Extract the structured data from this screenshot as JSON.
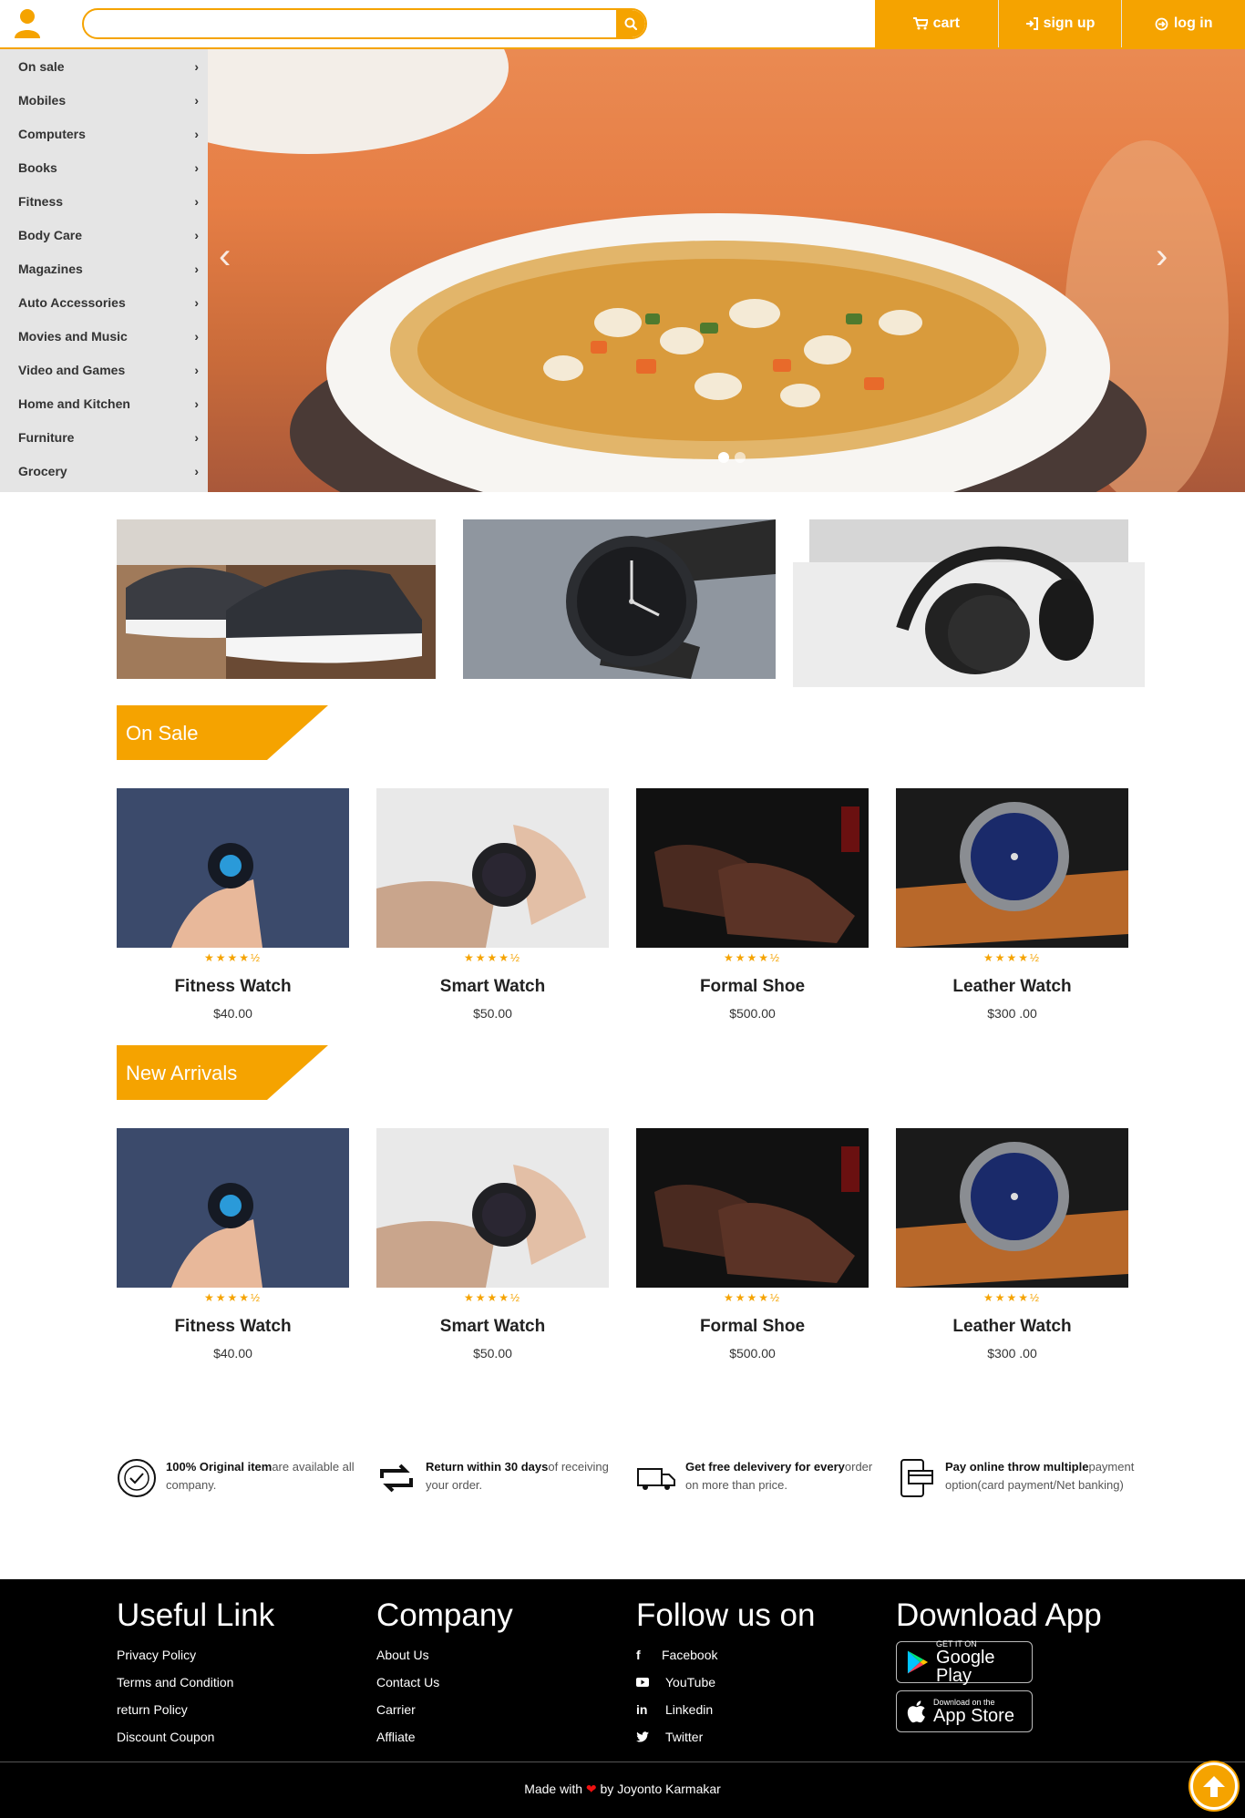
{
  "header": {
    "search_placeholder": "",
    "nav": [
      {
        "label": "cart",
        "icon": "cart-icon"
      },
      {
        "label": "sign up",
        "icon": "sign-in-icon"
      },
      {
        "label": "log in",
        "icon": "login-circle-icon"
      }
    ]
  },
  "sidebar": {
    "items": [
      "On sale",
      "Mobiles",
      "Computers",
      "Books",
      "Fitness",
      "Body Care",
      "Magazines",
      "Auto Accessories",
      "Movies and Music",
      "Video and Games",
      "Home and Kitchen",
      "Furniture",
      "Grocery"
    ]
  },
  "carousel": {
    "slides": 2,
    "active_slide": 1
  },
  "sections": {
    "on_sale": "On Sale",
    "new_arrivals": "New Arrivals"
  },
  "products": [
    {
      "name": "Fitness Watch",
      "price": "$40.00",
      "rating": 4.5
    },
    {
      "name": "Smart Watch",
      "price": "$50.00",
      "rating": 4.5
    },
    {
      "name": "Formal Shoe",
      "price": "$500.00",
      "rating": 4.5
    },
    {
      "name": "Leather Watch",
      "price": "$300 .00",
      "rating": 4.5
    }
  ],
  "features": [
    {
      "bold": "100% Original item",
      "text": "are available all company."
    },
    {
      "bold": "Return within 30 days",
      "text": "of receiving your order."
    },
    {
      "bold": "Get free delevivery for every",
      "text": "order on more than price."
    },
    {
      "bold": "Pay online throw multiple",
      "text": "payment option(card payment/Net banking)"
    }
  ],
  "footer": {
    "useful": {
      "title": "Useful Link",
      "links": [
        "Privacy Policy",
        "Terms and Condition",
        "return Policy",
        "Discount Coupon"
      ]
    },
    "company": {
      "title": "Company",
      "links": [
        "About Us",
        "Contact Us",
        "Carrier",
        "Affliate"
      ]
    },
    "follow": {
      "title": "Follow us on",
      "links": [
        "Facebook",
        "YouTube",
        "Linkedin",
        "Twitter"
      ]
    },
    "download": {
      "title": "Download App",
      "google": {
        "small": "GET IT ON",
        "big": "Google Play"
      },
      "apple": {
        "small": "Download on the",
        "big": "App Store"
      }
    },
    "credit_prefix": "Made with",
    "credit_suffix": "by Joyonto Karmakar"
  },
  "colors": {
    "accent": "#f5a300",
    "footer_bg": "#000000",
    "sidebar_bg": "#e5e5e5"
  }
}
